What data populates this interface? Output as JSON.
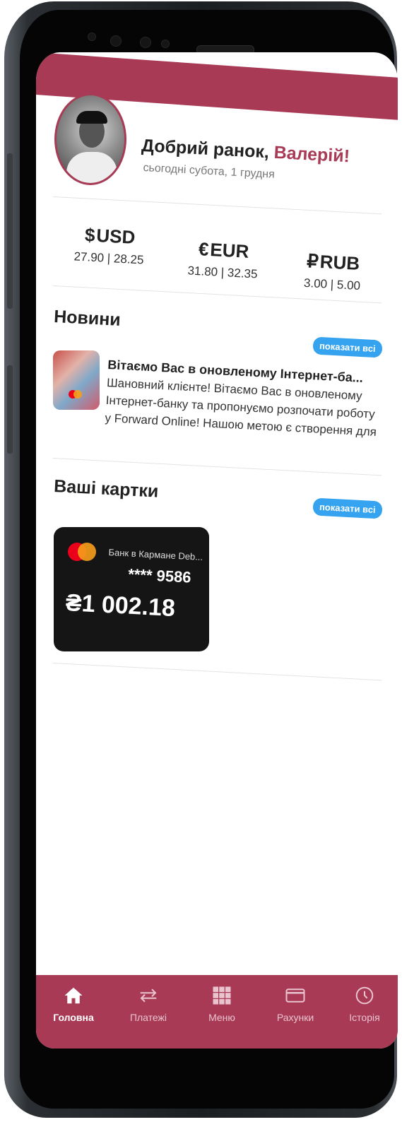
{
  "profile": {
    "greeting": "Добрий ранок, ",
    "name": "Валерій!",
    "date": "сьогодні субота, 1 грудня"
  },
  "currencies": [
    {
      "symbol": "$",
      "code": "USD",
      "rates": "27.90 | 28.25"
    },
    {
      "symbol": "€",
      "code": "EUR",
      "rates": "31.80 | 32.35"
    },
    {
      "symbol": "₽",
      "code": "RUB",
      "rates": "3.00 | 5.00"
    }
  ],
  "news": {
    "title": "Новини",
    "show_all": "показати всі",
    "item": {
      "title": "Вітаємо Вас в оновленому Інтернет-ба...",
      "body": "Шановний клієнте! Вітаємо Вас в оновленому Інтернет-банку та пропонуємо розпочати роботу у Forward Online! Нашою метою є створення для"
    }
  },
  "cards": {
    "title": "Ваші картки",
    "show_all": "показати всі",
    "card": {
      "name": "Банк в Кармане Deb...",
      "number": "**** 9586",
      "balance": "₴1 002.18"
    }
  },
  "tabbar": {
    "items": [
      {
        "label": "Головна",
        "icon": "home-icon",
        "active": true
      },
      {
        "label": "Платежі",
        "icon": "arrows-icon",
        "active": false
      },
      {
        "label": "Меню",
        "icon": "grid-icon",
        "active": false
      },
      {
        "label": "Рахунки",
        "icon": "card-icon",
        "active": false
      },
      {
        "label": "Історія",
        "icon": "clock-icon",
        "active": false
      }
    ]
  },
  "colors": {
    "brand": "#a83a56",
    "accent": "#35a3ef",
    "card_bg": "#151515"
  }
}
